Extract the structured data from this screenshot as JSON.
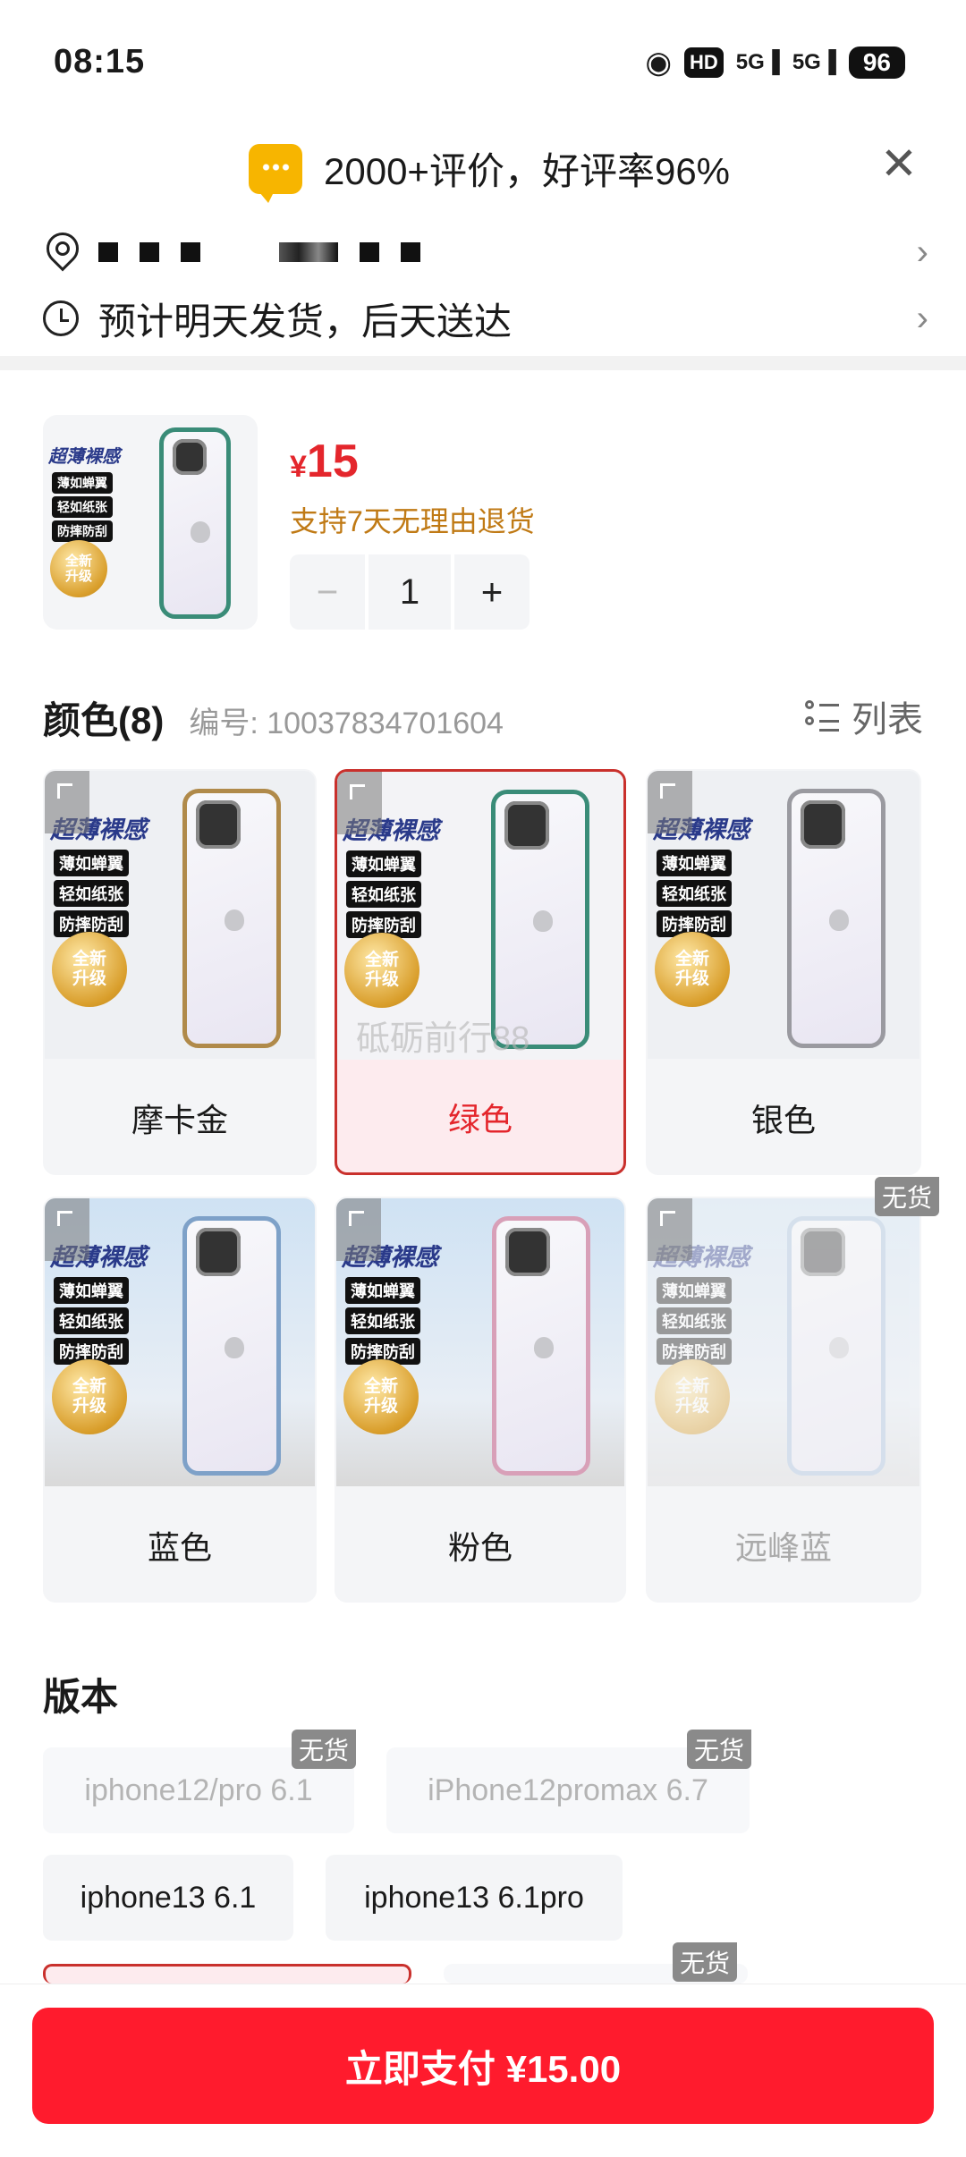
{
  "status_bar": {
    "time": "08:15",
    "hd_label": "HD",
    "signal_1": "5G",
    "signal_2": "5G",
    "battery": "96"
  },
  "review_banner": {
    "text": "2000+评价，好评率96%"
  },
  "shipping": {
    "text": "预计明天发货，后天送达"
  },
  "product": {
    "price_symbol": "¥",
    "price": "15",
    "return_policy": "支持7天无理由退货",
    "quantity": "1",
    "minus": "−",
    "plus": "+"
  },
  "promo": {
    "title": "超薄裸感",
    "tags": [
      "薄如蝉翼",
      "轻如纸张",
      "防摔防刮"
    ],
    "seal": "全新\n升级"
  },
  "color_section": {
    "title": "颜色(8)",
    "sku_label": "编号: 10037834701604",
    "list_label": "列表",
    "options": [
      {
        "label": "摩卡金",
        "state": "normal",
        "frame_color": "#b08a4a"
      },
      {
        "label": "绿色",
        "state": "selected",
        "frame_color": "#3a8c78"
      },
      {
        "label": "银色",
        "state": "normal",
        "frame_color": "#9a9aa0"
      },
      {
        "label": "蓝色",
        "state": "normal",
        "frame_color": "#7ea1c8"
      },
      {
        "label": "粉色",
        "state": "normal",
        "frame_color": "#d8a0b8"
      },
      {
        "label": "远峰蓝",
        "state": "out_of_stock",
        "frame_color": "#a8c0dc"
      }
    ],
    "out_of_stock_badge": "无货",
    "watermark": "砥砺前行88"
  },
  "version_section": {
    "title": "版本",
    "options": [
      {
        "label": "iphone12/pro 6.1",
        "state": "out_of_stock"
      },
      {
        "label": "iPhone12promax 6.7",
        "state": "out_of_stock"
      },
      {
        "label": "iphone13 6.1",
        "state": "normal"
      },
      {
        "label": "iphone13 6.1pro",
        "state": "normal"
      }
    ],
    "out_of_stock_badge": "无货"
  },
  "pay_button": {
    "label": "立即支付 ¥15.00"
  },
  "colors": {
    "accent_red": "#ff1b2d",
    "price_red": "#e4262c",
    "policy_orange": "#c07a15"
  }
}
